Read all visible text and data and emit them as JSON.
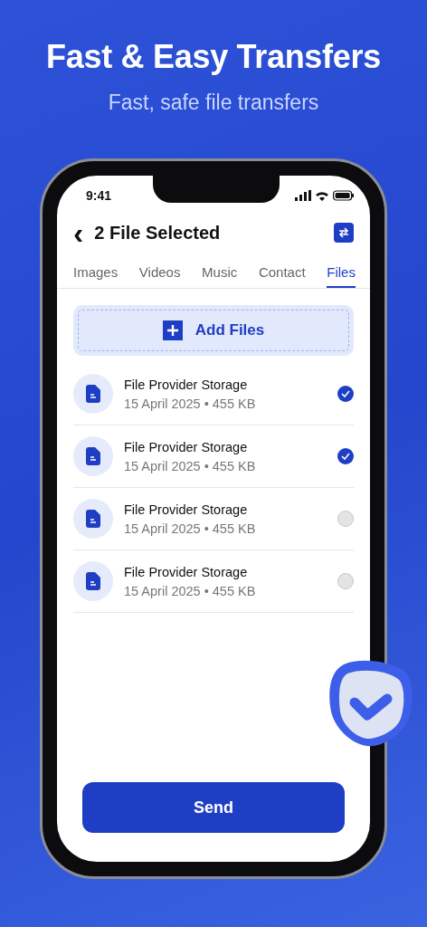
{
  "headline": "Fast & Easy Transfers",
  "subtitle": "Fast, safe file transfers",
  "status_bar": {
    "time": "9:41"
  },
  "header": {
    "back": "‹",
    "title": "2 File Selected"
  },
  "tabs": [
    {
      "label": "Images",
      "selected": false
    },
    {
      "label": "Videos",
      "selected": false
    },
    {
      "label": "Music",
      "selected": false
    },
    {
      "label": "Contact",
      "selected": false
    },
    {
      "label": "Files",
      "selected": true
    }
  ],
  "add_button": {
    "label": "Add Files"
  },
  "files": [
    {
      "name": "File Provider Storage",
      "meta": "15 April 2025 • 455 KB",
      "checked": true
    },
    {
      "name": "File Provider Storage",
      "meta": "15 April 2025 • 455 KB",
      "checked": true
    },
    {
      "name": "File Provider Storage",
      "meta": "15 April 2025 • 455 KB",
      "checked": false
    },
    {
      "name": "File Provider Storage",
      "meta": "15 April 2025 • 455 KB",
      "checked": false
    }
  ],
  "send_button": {
    "label": "Send"
  }
}
